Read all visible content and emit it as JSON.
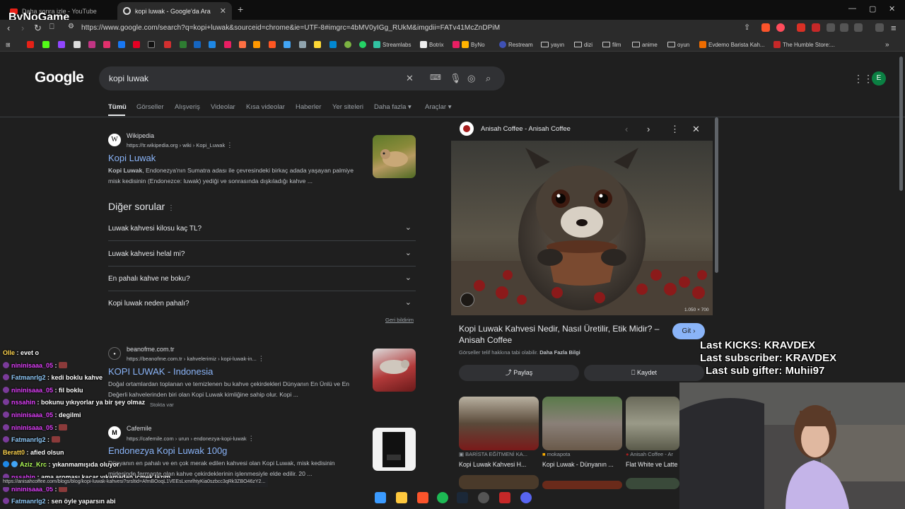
{
  "browser": {
    "tabs": [
      {
        "title": "Daha sonra izle - YouTube",
        "active": false
      },
      {
        "title": "kopi luwak - Google'da Ara",
        "active": true
      }
    ],
    "url": "https://www.google.com/search?q=kopi+luwak&sourceid=chrome&ie=UTF-8#imgrc=4bMV0yIGg_RUkM&imgdii=FATv41McZnDPiM",
    "bookmarks": [
      "Streamlabs",
      "Botrix",
      "ByNo",
      "Restream",
      "yayın",
      "dizi",
      "film",
      "anime",
      "oyun",
      "Evdemo Barista Kah...",
      "The Humble Store:..."
    ]
  },
  "google": {
    "logo": "Google",
    "query": "kopi luwak",
    "avatar_letter": "E",
    "tabs": [
      "Tümü",
      "Görseller",
      "Alışveriş",
      "Videolar",
      "Kısa videolar",
      "Haberler",
      "Yer siteleri",
      "Daha fazla",
      "Araçlar"
    ],
    "results": [
      {
        "site": "Wikipedia",
        "url": "https://tr.wikipedia.org › wiki › Kopi_Luwak",
        "title": "Kopi Luwak",
        "snippet_bold": "Kopi Luwak",
        "snippet": ", Endonezya'nın Sumatra adası ile çevresindeki birkaç adada yaşayan palmiye misk kedisinin (Endonezce: luwak) yediği ve sonrasında dışkıladığı kahve ..."
      },
      {
        "site": "beanofme.com.tr",
        "url": "https://beanofme.com.tr › kahvelerimiz › kopi-luwak-in...",
        "title": "KOPI LUWAK - Indonesia",
        "snippet": "Doğal ortamlardan toplanan ve temizlenen bu kahve çekirdekleri Dünyanın En Ünlü ve En Değerli kahvelerinden biri olan Kopi Luwak kimliğine sahip olur. Kopi ...",
        "stock": "Stokta var"
      },
      {
        "site": "Cafemile",
        "url": "https://cafemile.com › urun › endonezya-kopi-luwak",
        "title": "Endonezya Kopi Luwak 100g",
        "snippet": "Dünyanın en pahalı ve en çok merak edilen kahvesi olan Kopi Luwak, misk kedisinin midesinde fermante olan kahve çekirdeklerinin işlenmesiyle elde edilir. 20 ..."
      }
    ],
    "paa_title": "Diğer sorular",
    "paa": [
      "Luwak kahvesi kilosu kaç TL?",
      "Luwak kahvesi helal mi?",
      "En pahalı kahve ne boku?",
      "Kopi luwak neden pahalı?"
    ],
    "feedback": "Geri bildirim"
  },
  "panel": {
    "source": "Anisah Coffee - Anisah Coffee",
    "size": "1.050 × 700",
    "title": "Kopi Luwak Kahvesi Nedir, Nasıl Üretilir, Etik Midir? – Anisah Coffee",
    "go": "Git",
    "copyright": "Görseller telif hakkına tabi olabilir.",
    "more_info": "Daha Fazla Bilgi",
    "share": "Paylaş",
    "save": "Kaydet",
    "related": [
      {
        "src": "BARİSTA EĞİTMENİ KA...",
        "title": "Kopi Luwak Kahvesi H..."
      },
      {
        "src": "mokapota",
        "title": "Kopi Luwak - Dünyanın ..."
      },
      {
        "src": "Anisah Coffee - Ar",
        "title": "Flat White ve Latte"
      }
    ]
  },
  "stream": {
    "brand": "ByNoGame",
    "kicks": [
      "Last KICKS: KRAVDEX",
      "Last subscriber: KRAVDEX",
      "Last sub gifter: Muhii97"
    ],
    "chat": [
      {
        "user": "Olle",
        "msg": "evet o"
      },
      {
        "user": "nininisaaa_05",
        "msg": ""
      },
      {
        "user": "Fatmanrlg2",
        "msg": "kedi boklu kahve"
      },
      {
        "user": "nininisaaa_05",
        "msg": "fil boklu"
      },
      {
        "user": "nssahin",
        "msg": "bokunu yıkıyorlar ya bir şey olmaz"
      },
      {
        "user": "nininisaaa_05",
        "msg": "degilmi"
      },
      {
        "user": "nininisaaa_05",
        "msg": ""
      },
      {
        "user": "Fatmanrlg2",
        "msg": ""
      },
      {
        "user": "Beratt0",
        "msg": "afied olsun"
      },
      {
        "user": "Aziz_Krc",
        "msg": "yıkanmamışıda oluyor"
      },
      {
        "user": "nssahin",
        "msg": "ama aroması kaçar yıkamadan içmek lazım"
      },
      {
        "user": "nininisaaa_05",
        "msg": ""
      },
      {
        "user": "Fatmanrlg2",
        "msg": "sen öyle yaparsın abi"
      }
    ],
    "hover_url": "https://anisahcoffee.com/blogs/blog/kopi-luwak-kahvesi?srsltid=AfmBOoqL1VEEsLxmrlhtyKia0szbcc3qRk3ZBO46zY2..."
  }
}
